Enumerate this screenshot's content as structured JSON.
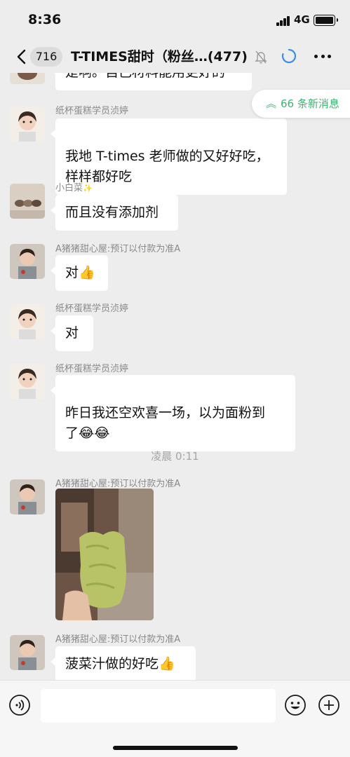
{
  "status_bar": {
    "time": "8:36",
    "network": "4G"
  },
  "nav": {
    "unread_count": "716",
    "title": "T-TIMES甜时（粉丝…(477)"
  },
  "new_messages": {
    "label": "66 条新消息",
    "color": "#3fb26f"
  },
  "messages": [
    {
      "sender": "",
      "text": "是啊。自己材料能用更好的"
    },
    {
      "sender": "纸杯蛋糕学员浈婷",
      "text": "我地 T-times 老师做的又好好吃，\n样样都好吃"
    },
    {
      "sender": "小白菜",
      "sender_icon": "sparkle",
      "text": "而且没有添加剂"
    },
    {
      "sender": "A猪猪甜心屋:预订以付款为准A",
      "text": "对",
      "emoji": "👍"
    },
    {
      "sender": "纸杯蛋糕学员浈婷",
      "text": "对"
    },
    {
      "sender": "纸杯蛋糕学员浈婷",
      "text": "昨日我还空欢喜一场，以为面粉到\n了",
      "emoji": "😂😂"
    },
    {
      "timestamp": "凌晨 0:11"
    },
    {
      "sender": "A猪猪甜心屋:预订以付款为准A",
      "image": "green-steamed-cake-photo"
    },
    {
      "sender": "A猪猪甜心屋:预订以付款为准A",
      "text": "菠菜汁做的好吃",
      "emoji": "👍"
    }
  ],
  "input_bar": {
    "placeholder": ""
  }
}
